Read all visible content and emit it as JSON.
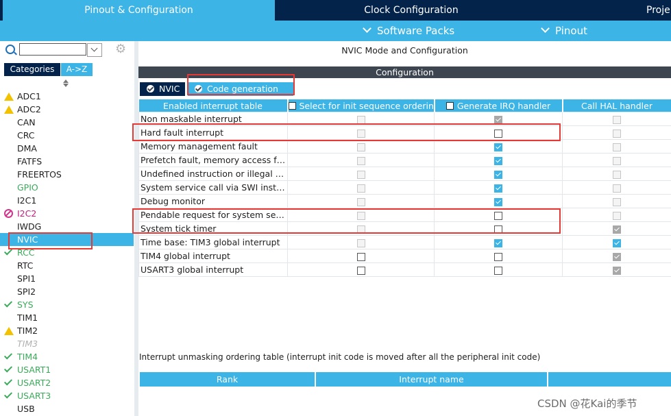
{
  "top_tabs": [
    {
      "label": "Pinout & Configuration",
      "active": true
    },
    {
      "label": "Clock Configuration",
      "active": false
    },
    {
      "label": "Proje",
      "active": false
    }
  ],
  "sub_menu": {
    "software_packs": "Software Packs",
    "pinout": "Pinout"
  },
  "left_panel": {
    "search": {
      "value": "",
      "placeholder": ""
    },
    "tabs": [
      {
        "label": "Categories"
      },
      {
        "label": "A->Z"
      }
    ],
    "peripherals": [
      {
        "name": "ADC1",
        "status": "warning"
      },
      {
        "name": "ADC2",
        "status": "warning"
      },
      {
        "name": "CAN",
        "status": "none"
      },
      {
        "name": "CRC",
        "status": "none"
      },
      {
        "name": "DMA",
        "status": "none"
      },
      {
        "name": "FATFS",
        "status": "none"
      },
      {
        "name": "FREERTOS",
        "status": "none"
      },
      {
        "name": "GPIO",
        "status": "green"
      },
      {
        "name": "I2C1",
        "status": "none"
      },
      {
        "name": "I2C2",
        "status": "disabled"
      },
      {
        "name": "IWDG",
        "status": "none"
      },
      {
        "name": "NVIC",
        "status": "selected"
      },
      {
        "name": "RCC",
        "status": "ok"
      },
      {
        "name": "RTC",
        "status": "none"
      },
      {
        "name": "SPI1",
        "status": "none"
      },
      {
        "name": "SPI2",
        "status": "none"
      },
      {
        "name": "SYS",
        "status": "ok"
      },
      {
        "name": "TIM1",
        "status": "none"
      },
      {
        "name": "TIM2",
        "status": "warning"
      },
      {
        "name": "TIM3",
        "status": "unavailable"
      },
      {
        "name": "TIM4",
        "status": "ok"
      },
      {
        "name": "USART1",
        "status": "ok"
      },
      {
        "name": "USART2",
        "status": "ok"
      },
      {
        "name": "USART3",
        "status": "ok"
      },
      {
        "name": "USB",
        "status": "none"
      }
    ]
  },
  "main": {
    "title": "NVIC Mode and Configuration",
    "config_label": "Configuration",
    "inner_tabs": [
      {
        "label": "NVIC"
      },
      {
        "label": "Code generation"
      }
    ],
    "table": {
      "headers": [
        "Enabled interrupt table",
        "Select for init sequence ordering",
        "Generate IRQ handler",
        "Call HAL handler"
      ],
      "rows": [
        {
          "name": "Non maskable interrupt",
          "select": [
            false,
            true
          ],
          "gen": [
            true,
            true
          ],
          "hal": [
            false,
            true
          ]
        },
        {
          "name": "Hard fault interrupt",
          "select": [
            false,
            true
          ],
          "gen": [
            false,
            false
          ],
          "hal": [
            false,
            true
          ]
        },
        {
          "name": "Memory management fault",
          "select": [
            false,
            true
          ],
          "gen": [
            true,
            false
          ],
          "hal": [
            false,
            true
          ]
        },
        {
          "name": "Prefetch fault, memory access fault",
          "select": [
            false,
            true
          ],
          "gen": [
            true,
            false
          ],
          "hal": [
            false,
            true
          ]
        },
        {
          "name": "Undefined instruction or illegal state",
          "select": [
            false,
            true
          ],
          "gen": [
            true,
            false
          ],
          "hal": [
            false,
            true
          ]
        },
        {
          "name": "System service call via SWI instru...",
          "select": [
            false,
            true
          ],
          "gen": [
            true,
            false
          ],
          "hal": [
            false,
            true
          ]
        },
        {
          "name": "Debug monitor",
          "select": [
            false,
            true
          ],
          "gen": [
            true,
            false
          ],
          "hal": [
            false,
            true
          ]
        },
        {
          "name": "Pendable request for system service",
          "select": [
            false,
            true
          ],
          "gen": [
            false,
            false
          ],
          "hal": [
            false,
            true
          ]
        },
        {
          "name": "System tick timer",
          "select": [
            false,
            true
          ],
          "gen": [
            false,
            false
          ],
          "hal": [
            true,
            true
          ]
        },
        {
          "name": "Time base: TIM3 global interrupt",
          "select": [
            false,
            true
          ],
          "gen": [
            true,
            false
          ],
          "hal": [
            true,
            false
          ]
        },
        {
          "name": "TIM4 global interrupt",
          "select": [
            false,
            false
          ],
          "gen": [
            false,
            false
          ],
          "hal": [
            true,
            true
          ]
        },
        {
          "name": "USART3 global interrupt",
          "select": [
            false,
            false
          ],
          "gen": [
            false,
            false
          ],
          "hal": [
            true,
            true
          ]
        }
      ]
    },
    "unmask_note": "Interrupt unmasking ordering table (interrupt init code is moved after all the peripheral init code)",
    "unmask_headers": [
      "Rank",
      "Interrupt name",
      ""
    ]
  },
  "watermark": "CSDN @花Kai的季节",
  "colors": {
    "navy": "#03234b",
    "accent": "#3cb4e6",
    "dark_band": "#3d4650",
    "highlight": "#e53935"
  }
}
